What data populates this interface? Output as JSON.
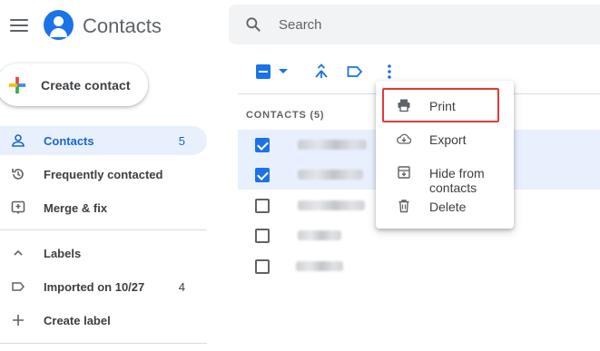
{
  "header": {
    "app_title": "Contacts",
    "search_placeholder": "Search"
  },
  "create_contact": {
    "label": "Create contact"
  },
  "sidebar": {
    "items": [
      {
        "label": "Contacts",
        "count": "5",
        "icon": "person-icon",
        "active": true
      },
      {
        "label": "Frequently contacted",
        "count": "",
        "icon": "history-icon",
        "active": false
      },
      {
        "label": "Merge & fix",
        "count": "",
        "icon": "merge-fix-icon",
        "active": false
      }
    ],
    "labels_section": {
      "label": "Labels",
      "icon": "chevron-up-icon"
    },
    "label_items": [
      {
        "label": "Imported on 10/27",
        "count": "4",
        "icon": "label-outline-icon"
      }
    ],
    "create_label": {
      "label": "Create label",
      "icon": "plus-icon"
    }
  },
  "list": {
    "header": "CONTACTS (5)",
    "rows": [
      {
        "checked": true
      },
      {
        "checked": true
      },
      {
        "checked": false
      },
      {
        "checked": false
      },
      {
        "checked": false
      }
    ]
  },
  "menu": {
    "items": [
      {
        "label": "Print",
        "icon": "print-icon",
        "highlighted": true
      },
      {
        "label": "Export",
        "icon": "cloud-download-icon",
        "highlighted": false
      },
      {
        "label": "Hide from contacts",
        "icon": "archive-icon",
        "highlighted": false
      },
      {
        "label": "Delete",
        "icon": "trash-icon",
        "highlighted": false
      }
    ]
  },
  "colors": {
    "accent": "#1a73e8",
    "active_nav_bg": "#e8f0fe",
    "highlight_border": "#e53935"
  }
}
